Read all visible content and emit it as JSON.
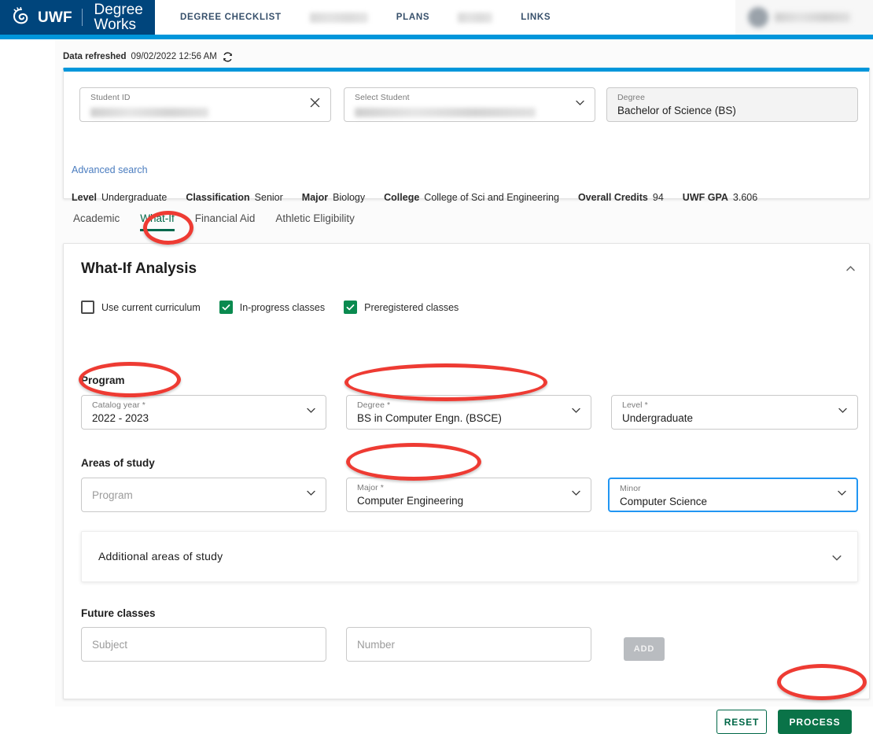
{
  "header": {
    "brand_uwf": "UWF",
    "brand_product": "Degree Works",
    "nav": [
      {
        "label": "DEGREE CHECKLIST",
        "blurred": false
      },
      {
        "label": "",
        "blurred": true
      },
      {
        "label": "PLANS",
        "blurred": false
      },
      {
        "label": "",
        "blurred": true
      },
      {
        "label": "LINKS",
        "blurred": false
      }
    ],
    "accent_color": "#0096db",
    "brand_color": "#00457c"
  },
  "refresh": {
    "label": "Data refreshed",
    "timestamp": "09/02/2022 12:56 AM",
    "icon": "refresh-icon"
  },
  "student_card": {
    "student_id": {
      "label": "Student ID",
      "value": "",
      "redacted": true
    },
    "select_student": {
      "label": "Select Student",
      "value": "",
      "redacted": true
    },
    "degree": {
      "label": "Degree",
      "value": "Bachelor of Science (BS)",
      "readonly": true
    },
    "advanced_search": "Advanced search",
    "summary": [
      {
        "key": "Level",
        "value": "Undergraduate"
      },
      {
        "key": "Classification",
        "value": "Senior"
      },
      {
        "key": "Major",
        "value": "Biology"
      },
      {
        "key": "College",
        "value": "College of Sci and Engineering"
      },
      {
        "key": "Overall Credits",
        "value": "94"
      },
      {
        "key": "UWF GPA",
        "value": "3.606"
      }
    ]
  },
  "tabs": [
    {
      "label": "Academic",
      "active": false
    },
    {
      "label": "What-If",
      "active": true
    },
    {
      "label": "Financial Aid",
      "active": false
    },
    {
      "label": "Athletic Eligibility",
      "active": false
    }
  ],
  "whatif": {
    "title": "What-If Analysis",
    "collapse_icon": "chevron-up-icon",
    "checkboxes": [
      {
        "label": "Use current curriculum",
        "checked": false
      },
      {
        "label": "In-progress classes",
        "checked": true
      },
      {
        "label": "Preregistered classes",
        "checked": true
      }
    ],
    "program_heading": "Program",
    "program_fields": [
      {
        "label": "Catalog year *",
        "value": "2022 - 2023",
        "placeholder": ""
      },
      {
        "label": "Degree *",
        "value": "BS in Computer Engn. (BSCE)",
        "placeholder": ""
      },
      {
        "label": "Level *",
        "value": "Undergraduate",
        "placeholder": ""
      }
    ],
    "areas_heading": "Areas of study",
    "areas_fields": [
      {
        "label": "",
        "value": "",
        "placeholder": "Program"
      },
      {
        "label": "Major *",
        "value": "Computer Engineering",
        "placeholder": ""
      },
      {
        "label": "Minor",
        "value": "Computer Science",
        "placeholder": "",
        "focused": true
      }
    ],
    "additional_areas": {
      "title": "Additional areas of study",
      "icon": "chevron-down-icon"
    },
    "future_heading": "Future classes",
    "future_fields": [
      {
        "placeholder": "Subject",
        "value": ""
      },
      {
        "placeholder": "Number",
        "value": ""
      }
    ],
    "add_label": "ADD",
    "reset_label": "RESET",
    "process_label": "PROCESS"
  },
  "colors": {
    "accent": "#0096db",
    "brand": "#00457c",
    "green": "#0a7348",
    "checkbox_green": "#0a8a4f",
    "annotation_red": "#ee3b33",
    "focus_blue": "#2196f3"
  }
}
